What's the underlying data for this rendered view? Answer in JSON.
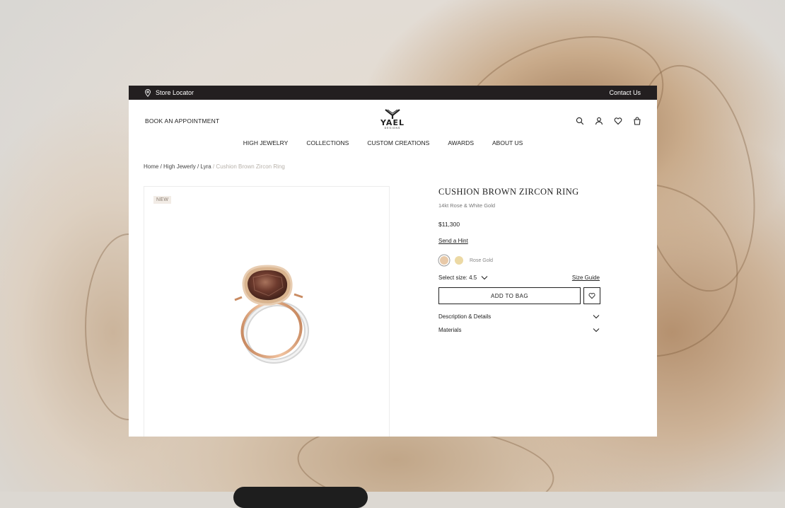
{
  "topbar": {
    "store_locator": "Store Locator",
    "contact": "Contact Us"
  },
  "header": {
    "book": "BOOK AN APPOINTMENT",
    "logo_word": "YAEL",
    "logo_sub": "DESIGNS",
    "icons": [
      "search-icon",
      "account-icon",
      "wishlist-icon",
      "bag-icon"
    ]
  },
  "nav": [
    "HIGH JEWELRY",
    "COLLECTIONS",
    "CUSTOM CREATIONS",
    "AWARDS",
    "ABOUT US"
  ],
  "breadcrumb": {
    "items": [
      "Home",
      "High Jewerly",
      "Lyra"
    ],
    "current": "Cushion Brown Zircon Ring",
    "sep": " / "
  },
  "product": {
    "badge": "NEW",
    "title": "CUSHION BROWN ZIRCON RING",
    "subtitle": "14kt Rose & White Gold",
    "price": "$11,300",
    "hint": "Send a Hint",
    "swatch_label": "Rose Gold",
    "swatch_colors": [
      "#e8c9a8",
      "#ecd9a4"
    ],
    "size_label": "Select size: 4.5",
    "size_guide": "Size Guide",
    "add_to_bag": "ADD TO BAG",
    "accordions": [
      "Description & Details",
      "Materials"
    ]
  }
}
